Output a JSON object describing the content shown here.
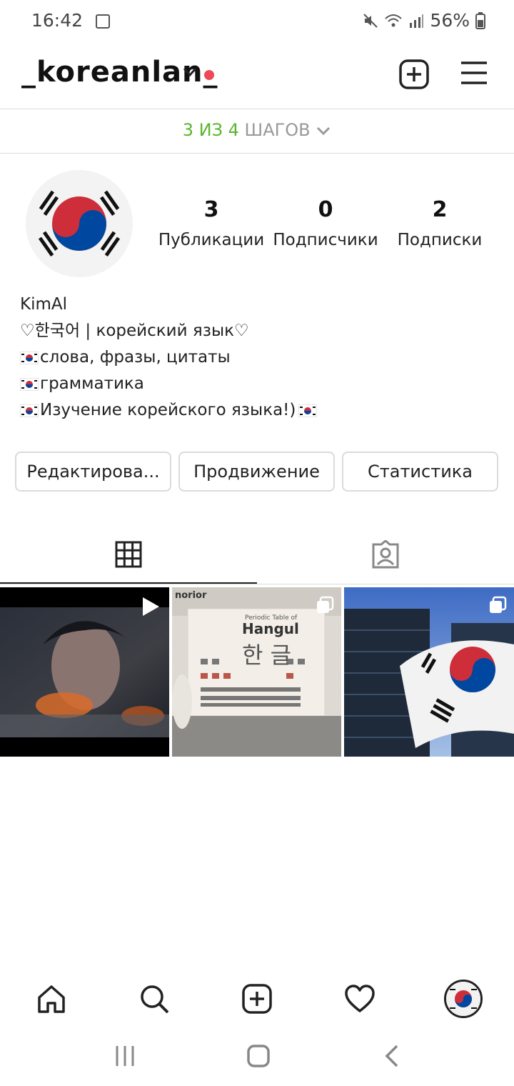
{
  "status": {
    "time": "16:42",
    "battery": "56%"
  },
  "header": {
    "username": "_koreanlan_"
  },
  "steps": {
    "done": "3 ИЗ 4",
    "label": "ШАГОВ"
  },
  "stats": [
    {
      "value": "3",
      "label": "Публикации"
    },
    {
      "value": "0",
      "label": "Подписчики"
    },
    {
      "value": "2",
      "label": "Подписки"
    }
  ],
  "bio": {
    "name": "KimAl",
    "line1": "♡한국어 | корейский язык♡",
    "line2": "слова, фразы, цитаты",
    "line3": "грамматика",
    "line4": "Изучение корейского языка!)"
  },
  "buttons": {
    "edit": "Редактирова...",
    "promote": "Продвижение",
    "insights": "Статистика"
  },
  "posts": [
    {
      "type": "video"
    },
    {
      "type": "carousel",
      "brand": "norior",
      "title_small": "Periodic Table of",
      "title": "Hangul",
      "korean": "한 글"
    },
    {
      "type": "carousel"
    }
  ],
  "colors": {
    "accent_red": "#ed4956",
    "steps_green": "#5bb52f",
    "flag_red": "#cd2e3a",
    "flag_blue": "#0047a0"
  }
}
